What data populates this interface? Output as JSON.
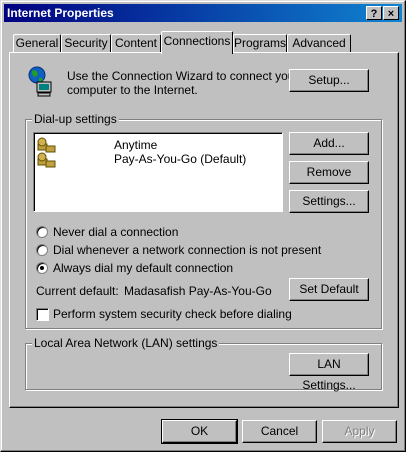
{
  "window": {
    "title": "Internet Properties",
    "help_glyph": "?",
    "close_glyph": "×"
  },
  "tabs": [
    {
      "label": "General"
    },
    {
      "label": "Security"
    },
    {
      "label": "Content"
    },
    {
      "label": "Connections",
      "active": true
    },
    {
      "label": "Programs"
    },
    {
      "label": "Advanced"
    }
  ],
  "wizard": {
    "text_line1": "Use the Connection Wizard to connect your",
    "text_line2": "computer to the Internet.",
    "setup_button": "Setup..."
  },
  "dialup": {
    "legend": "Dial-up settings",
    "connections": [
      "Anytime",
      "Pay-As-You-Go (Default)"
    ],
    "add_button": "Add...",
    "remove_button": "Remove",
    "settings_button": "Settings...",
    "radio_options": [
      {
        "label": "Never dial a connection",
        "checked": false
      },
      {
        "label": "Dial whenever a network connection is not present",
        "checked": false
      },
      {
        "label": "Always dial my default connection",
        "checked": true
      }
    ],
    "current_default_label": "Current default:",
    "current_default_value": "Madasafish Pay-As-You-Go",
    "set_default_button": "Set Default",
    "security_check_label": "Perform system security check before dialing",
    "security_check_checked": false
  },
  "lan": {
    "legend": "Local Area Network (LAN) settings",
    "lan_settings_button": "LAN Settings..."
  },
  "footer": {
    "ok": "OK",
    "cancel": "Cancel",
    "apply": "Apply"
  }
}
